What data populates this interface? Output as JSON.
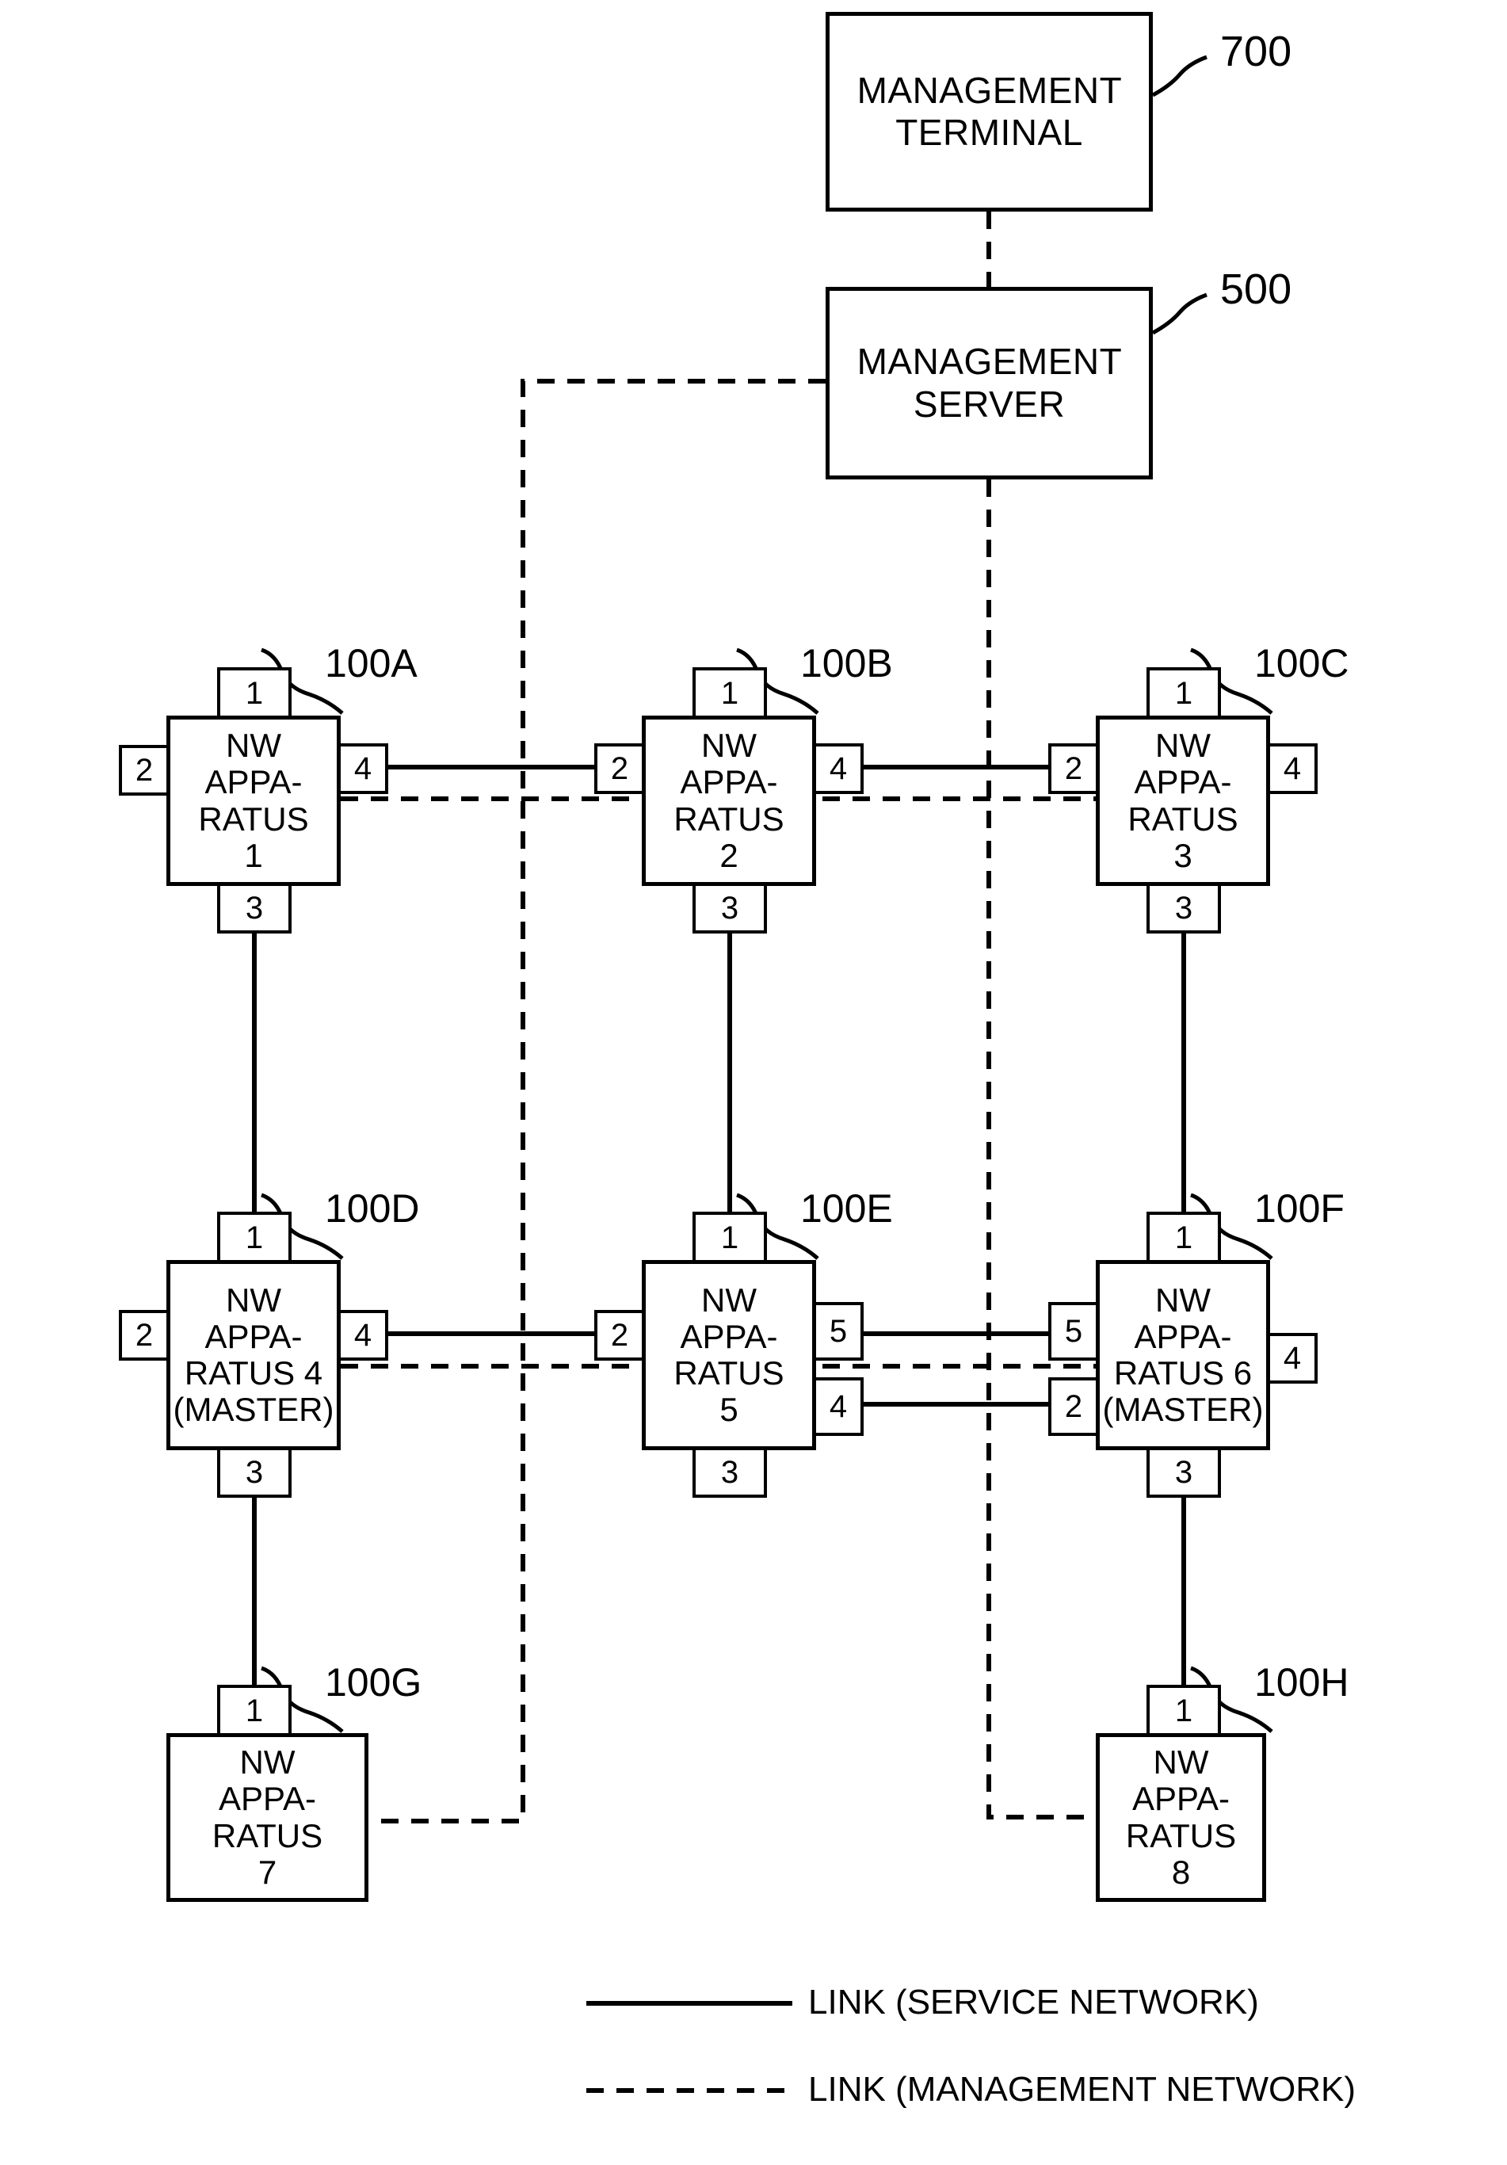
{
  "figure": {
    "title": "Network apparatus management topology",
    "line_color": "#000000",
    "background": "#ffffff"
  },
  "nodes": {
    "management_terminal": {
      "label_line1": "MANAGEMENT",
      "label_line2": "TERMINAL",
      "ref": "700"
    },
    "management_server": {
      "label_line1": "MANAGEMENT",
      "label_line2": "SERVER",
      "ref": "500"
    },
    "apparatus": [
      {
        "id": "100A",
        "ref": "100A",
        "line1": "NW",
        "line2": "APPA-",
        "line3": "RATUS",
        "line4": "1",
        "ports": {
          "top": "1",
          "left": "2",
          "right": "4",
          "bottom": "3"
        }
      },
      {
        "id": "100B",
        "ref": "100B",
        "line1": "NW",
        "line2": "APPA-",
        "line3": "RATUS",
        "line4": "2",
        "ports": {
          "top": "1",
          "left": "2",
          "right": "4",
          "bottom": "3"
        }
      },
      {
        "id": "100C",
        "ref": "100C",
        "line1": "NW",
        "line2": "APPA-",
        "line3": "RATUS",
        "line4": "3",
        "ports": {
          "top": "1",
          "left": "2",
          "right": "4",
          "bottom": "3"
        }
      },
      {
        "id": "100D",
        "ref": "100D",
        "line1": "NW",
        "line2": "APPA-",
        "line3": "RATUS 4",
        "line4": "(MASTER)",
        "ports": {
          "top": "1",
          "left": "2",
          "right": "4",
          "bottom": "3"
        }
      },
      {
        "id": "100E",
        "ref": "100E",
        "line1": "NW",
        "line2": "APPA-",
        "line3": "RATUS",
        "line4": "5",
        "ports": {
          "top": "1",
          "left": "2",
          "right_upper": "5",
          "right_lower": "4",
          "bottom": "3"
        }
      },
      {
        "id": "100F",
        "ref": "100F",
        "line1": "NW",
        "line2": "APPA-",
        "line3": "RATUS 6",
        "line4": "(MASTER)",
        "ports": {
          "top": "1",
          "left_upper": "5",
          "left_lower": "2",
          "right": "4",
          "bottom": "3"
        }
      },
      {
        "id": "100G",
        "ref": "100G",
        "line1": "NW",
        "line2": "APPA-",
        "line3": "RATUS",
        "line4": "7",
        "ports": {
          "top": "1"
        }
      },
      {
        "id": "100H",
        "ref": "100H",
        "line1": "NW",
        "line2": "APPA-",
        "line3": "RATUS",
        "line4": "8",
        "ports": {
          "top": "1"
        }
      }
    ]
  },
  "legend": {
    "items": [
      {
        "style": "solid",
        "label": "LINK (SERVICE NETWORK)"
      },
      {
        "style": "dashed",
        "label": "LINK (MANAGEMENT NETWORK)"
      }
    ]
  },
  "links": {
    "service": [
      "NW APPARATUS 1 port 4 — NW APPARATUS 2 port 2",
      "NW APPARATUS 2 port 4 — NW APPARATUS 3 port 2",
      "NW APPARATUS 1 port 3 — NW APPARATUS 4 port 1",
      "NW APPARATUS 2 port 3 — NW APPARATUS 5 port 1",
      "NW APPARATUS 3 port 3 — NW APPARATUS 6 port 1",
      "NW APPARATUS 4 port 4 — NW APPARATUS 5 port 2",
      "NW APPARATUS 5 port 5 — NW APPARATUS 6 port 5",
      "NW APPARATUS 5 port 4 — NW APPARATUS 6 port 2",
      "NW APPARATUS 4 port 3 — NW APPARATUS 7 port 1",
      "NW APPARATUS 6 port 3 — NW APPARATUS 8 port 1"
    ],
    "management": [
      "MANAGEMENT TERMINAL — MANAGEMENT SERVER",
      "MANAGEMENT SERVER — NW APPARATUS 1/2/4/5/7 (left management bus)",
      "MANAGEMENT SERVER — NW APPARATUS 3/6/8 (right management bus)"
    ]
  }
}
